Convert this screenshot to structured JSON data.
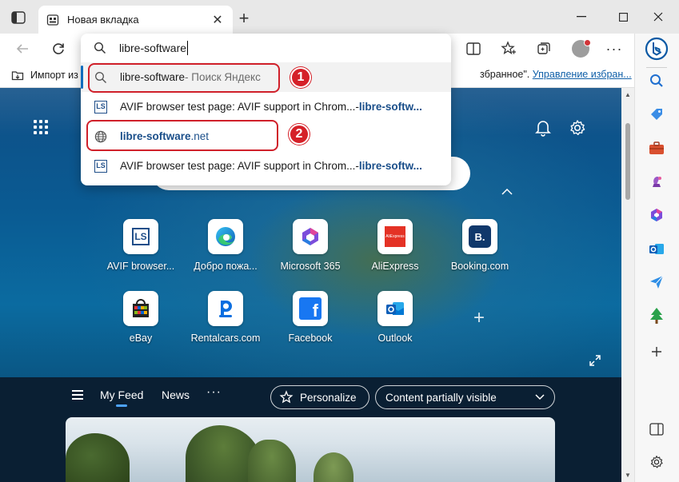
{
  "tab": {
    "title": "Новая вкладка",
    "close": "✕"
  },
  "new_tab": "+",
  "address": {
    "value": "libre-software"
  },
  "suggestions": [
    {
      "icon": "search-icon",
      "main": "libre-software",
      "suffix": " - Поиск Яндекс",
      "selected": true
    },
    {
      "icon": "ls-site-icon",
      "icon_text": "LS",
      "main": "AVIF browser test page: AVIF support in Chrom...",
      "suffix_sep": " - ",
      "suffix": "libre-softw...",
      "selected": false
    },
    {
      "icon": "globe-icon",
      "main_bold": "libre-software",
      "main_rest": ".net",
      "selected": false
    },
    {
      "icon": "ls-site-icon",
      "icon_text": "LS",
      "main": "AVIF browser test page: AVIF support in Chrom...",
      "suffix_sep": " - ",
      "suffix": "libre-softw...",
      "selected": false
    }
  ],
  "annotations": {
    "badge1": "1",
    "badge2": "2"
  },
  "favorites": {
    "import_label": "Импорт из",
    "right_text": "збранное\".",
    "manage_link": "Управление избран..."
  },
  "quick_links": [
    {
      "label": "AVIF browser...",
      "icon": "ls-site-icon",
      "icon_text": "LS"
    },
    {
      "label": "Добро пожа...",
      "icon": "edge-icon"
    },
    {
      "label": "Microsoft 365",
      "icon": "m365-icon"
    },
    {
      "label": "AliExpress",
      "icon": "aliexpress-icon",
      "icon_text": "AliExpress"
    },
    {
      "label": "Booking.com",
      "icon": "booking-icon",
      "icon_text": "B."
    },
    {
      "label": "eBay",
      "icon": "ebay-icon"
    },
    {
      "label": "Rentalcars.com",
      "icon": "rentalcars-icon"
    },
    {
      "label": "Facebook",
      "icon": "facebook-icon",
      "icon_text": "f"
    },
    {
      "label": "Outlook",
      "icon": "outlook-icon",
      "icon_text": "o"
    }
  ],
  "add_quick_link": "+",
  "feed": {
    "tabs": [
      "My Feed",
      "News"
    ],
    "active_tab": "My Feed",
    "more": "···",
    "personalize": "Personalize",
    "content_visibility": "Content partially visible"
  },
  "colors": {
    "accent": "#0f6cbd",
    "annotation_red": "#d52028",
    "edge_blue": "#0c59a4"
  }
}
